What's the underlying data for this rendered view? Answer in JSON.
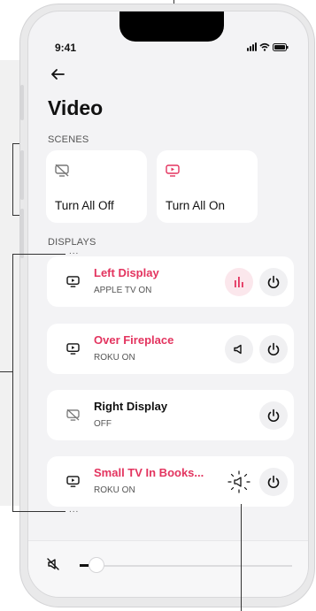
{
  "status_bar": {
    "time": "9:41",
    "signal_icon": "signal-icon",
    "wifi_icon": "wifi-icon",
    "battery_icon": "battery-icon"
  },
  "header": {
    "back_icon": "arrow-left-icon",
    "title": "Video"
  },
  "scenes": {
    "heading": "SCENES",
    "items": [
      {
        "label": "Turn All Off",
        "icon": "tv-off-icon"
      },
      {
        "label": "Turn All On",
        "icon": "tv-play-icon"
      }
    ]
  },
  "displays": {
    "heading": "DISPLAYS",
    "items": [
      {
        "name": "Left Display",
        "status": "APPLE TV ON",
        "active": true,
        "media_icon": "equalizer-icon"
      },
      {
        "name": "Over Fireplace",
        "status": "ROKU ON",
        "active": true,
        "media_icon": "volume-icon"
      },
      {
        "name": "Right Display",
        "status": "OFF",
        "active": false
      },
      {
        "name": "Small TV In Books...",
        "status": "ROKU ON",
        "active": true,
        "media_icon": "volume-active-icon"
      }
    ]
  },
  "volume": {
    "icon": "mute-icon",
    "level": 0.04
  },
  "annotations": {
    "dots": "..."
  },
  "colors": {
    "accent": "#e3345f",
    "accent_soft": "#fbe7ec",
    "card": "#ffffff",
    "screen": "#f3f3f5",
    "text": "#111111"
  }
}
